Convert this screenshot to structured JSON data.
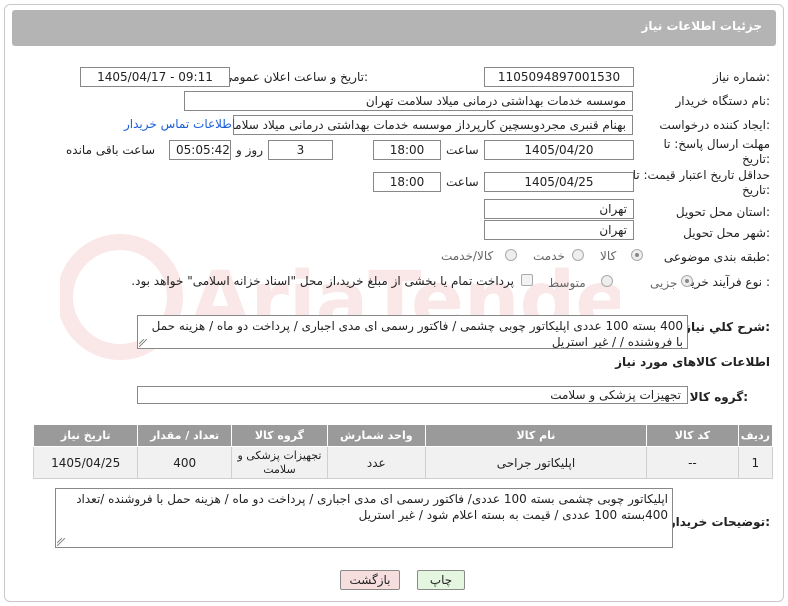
{
  "header": {
    "title": "جزئیات اطلاعات نیاز"
  },
  "fields": {
    "need_number_label": "شماره نیاز:",
    "need_number": "1105094897001530",
    "announce_label": "تاریخ و ساعت اعلان عمومی:",
    "announce_value": "1405/04/17 - 09:11",
    "buyer_org_label": "نام دستگاه خریدار:",
    "buyer_org": "موسسه خدمات بهداشتی درمانی میلاد سلامت تهران",
    "creator_label": "ایجاد کننده درخواست:",
    "creator": "بهنام قنبری مجردوبسچین کارپرداز موسسه خدمات بهداشتی درمانی میلاد سلامت تهران",
    "contact_link": "اطلاعات تماس خریدار",
    "deadline_label": "مهلت ارسال پاسخ: تا تاریخ:",
    "deadline_date": "1405/04/20",
    "time_label": "ساعت",
    "deadline_time": "18:00",
    "days_value": "3",
    "days_label": "روز و",
    "remaining_time": "05:05:42",
    "remaining_label": "ساعت باقی مانده",
    "validity_label": "حداقل تاریخ اعتبار قیمت: تا تاریخ:",
    "validity_date": "1405/04/25",
    "validity_time": "18:00",
    "province_label": "استان محل تحویل:",
    "province": "تهران",
    "city_label": "شهر محل تحویل:",
    "city": "تهران",
    "category_label": "طبقه بندی موضوعی:",
    "category_options": [
      "کالا",
      "خدمت",
      "کالا/خدمت"
    ],
    "process_label": "نوع فرآیند خرید :",
    "process_options": [
      "جزیی",
      "متوسط"
    ],
    "payment_note": "پرداخت تمام یا بخشی از مبلغ خرید،از محل \"اسناد خزانه اسلامی\" خواهد بود.",
    "general_desc_label": "شرح کلي نياز:",
    "general_desc": "400 بسته 100  عددی اپلیکاتور چوبی چشمی  / فاکتور رسمی ای مدی اجباری / پرداخت دو ماه / هزینه حمل با فروشنده /  / غیر استریل",
    "goods_info_title": "اطلاعات کالاهای مورد نیاز",
    "goods_group_label": "گروه کالا:",
    "goods_group": "تجهیزات پزشکی و سلامت",
    "buyer_notes_label": "توضیحات خریدار:",
    "buyer_notes": "اپلیکاتور چوبی چشمی  بسته 100 عددی/ فاکتور رسمی ای مدی اجباری / پرداخت دو ماه / هزینه حمل با فروشنده  /تعداد 400بسته 100 عددی / قیمت به بسته اعلام شود / غیر استریل"
  },
  "table": {
    "headers": [
      "ردیف",
      "کد کالا",
      "نام کالا",
      "واحد شمارش",
      "گروه کالا",
      "تعداد / مقدار",
      "تاریخ نیاز"
    ],
    "rows": [
      [
        "1",
        "--",
        "اپلیکاتور جراحی",
        "عدد",
        "تجهیزات پزشکی و سلامت",
        "400",
        "1405/04/25"
      ]
    ]
  },
  "buttons": {
    "print": "چاپ",
    "back": "بازگشت"
  },
  "watermark_text": "AriaTender.net",
  "colors": {
    "header_bg": "#b4b4b4",
    "table_header_bg": "#9a9a9a",
    "link": "#1a5ed8",
    "back_btn_bg": "#f7dede",
    "print_btn_bg": "#e4f5e0"
  }
}
